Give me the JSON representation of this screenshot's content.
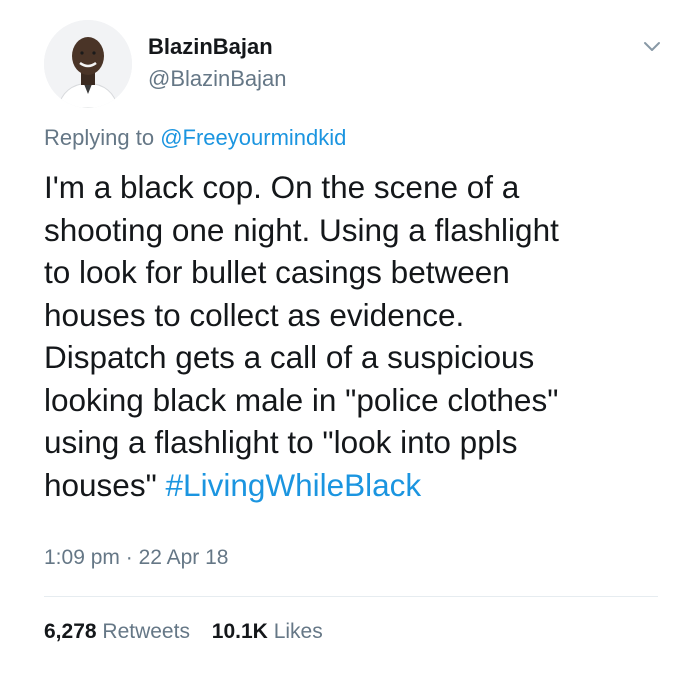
{
  "user": {
    "display_name": "BlazinBajan",
    "handle": "@BlazinBajan",
    "avatar_icon": "person-avatar"
  },
  "reply": {
    "prefix": "Replying to",
    "mention": "@Freeyourmindkid"
  },
  "tweet": {
    "lines": [
      "I'm a black cop. On the scene of a",
      "shooting one night. Using a flashlight",
      "to look for bullet casings between",
      "houses to collect as evidence.",
      "Dispatch gets a call of a suspicious",
      "looking black male in \"police clothes\"",
      "using a flashlight to \"look into ppls",
      "houses\""
    ],
    "hashtag": "#LivingWhileBlack"
  },
  "meta": {
    "time": "1:09 pm",
    "separator": "·",
    "date": "22 Apr 18"
  },
  "stats": {
    "retweets_count": "6,278",
    "retweets_label": "Retweets",
    "likes_count": "10.1K",
    "likes_label": "Likes"
  },
  "colors": {
    "link": "#1b95e0",
    "secondary": "#657786",
    "primary": "#14171a",
    "divider": "#e6ecf0"
  },
  "icons": {
    "menu": "chevron-down-icon"
  }
}
